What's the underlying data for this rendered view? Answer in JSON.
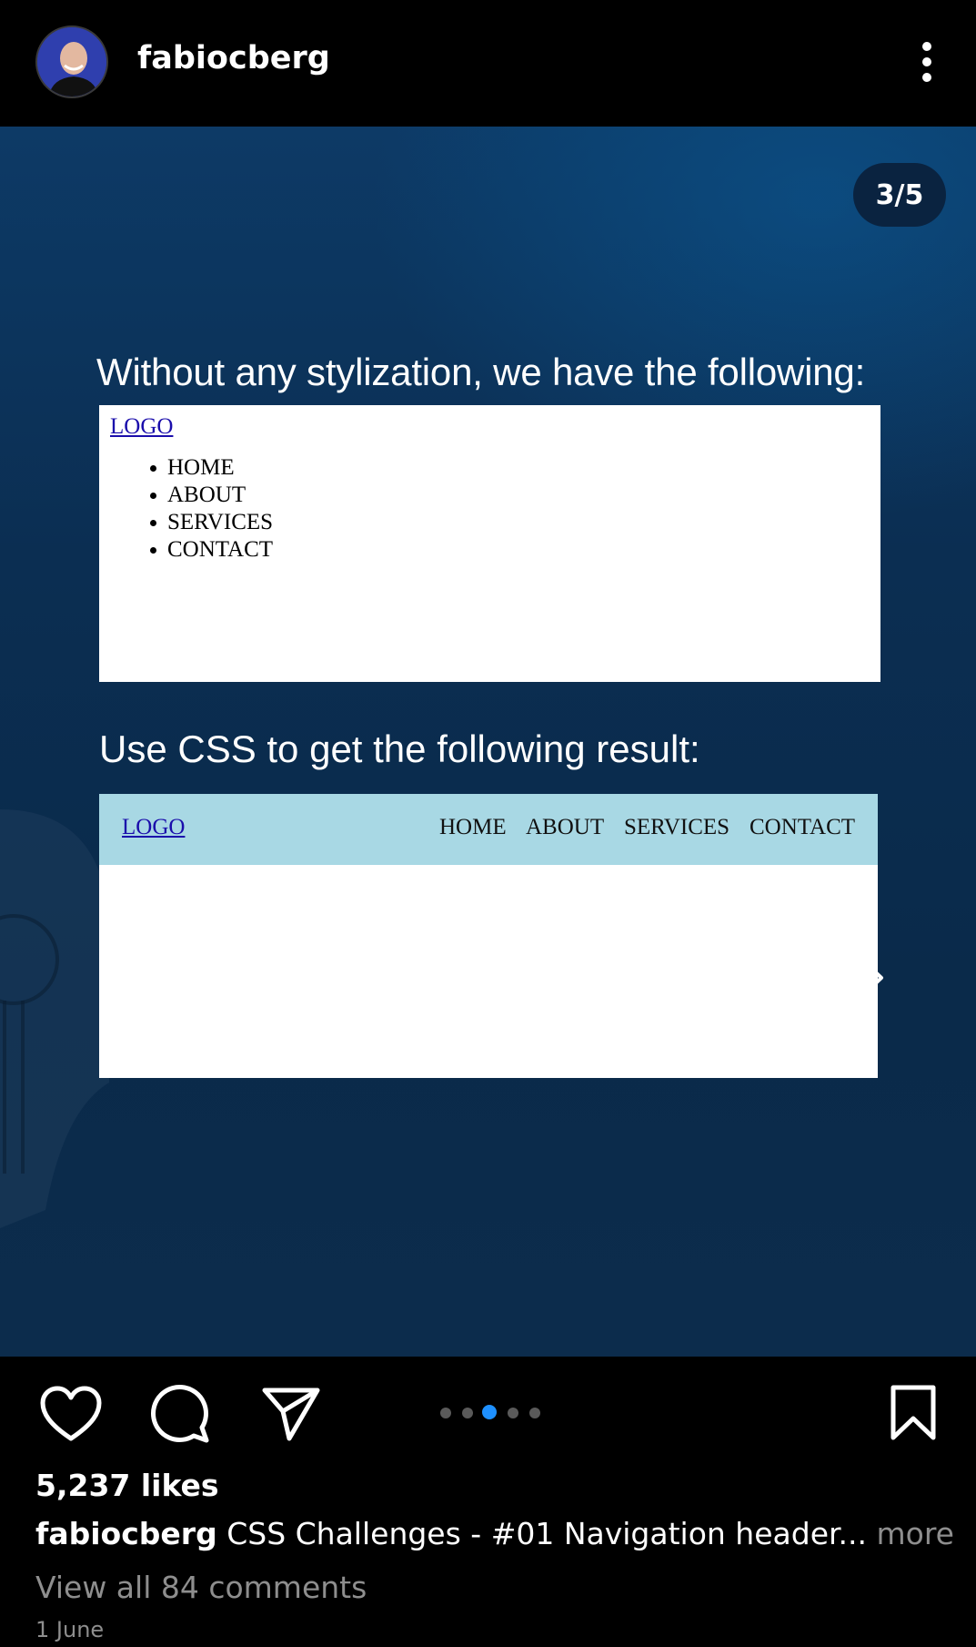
{
  "header": {
    "username": "fabiocberg",
    "avatar_icon": "profile-avatar",
    "more_icon": "more-vertical-icon"
  },
  "post": {
    "counter": "3/5",
    "intro_text": "Without any stylization, we have the following:",
    "unstyled": {
      "logo": "LOGO",
      "items": [
        "HOME",
        "ABOUT",
        "SERVICES",
        "CONTACT"
      ]
    },
    "instruction_text": "Use CSS to get the following result:",
    "styled": {
      "logo": "LOGO",
      "items": [
        "HOME",
        "ABOUT",
        "SERVICES",
        "CONTACT"
      ],
      "navbar_color": "#a8d8e4"
    },
    "arrow_icon": "arrow-right-icon"
  },
  "actions": {
    "like_icon": "heart-icon",
    "comment_icon": "comment-icon",
    "share_icon": "send-icon",
    "save_icon": "bookmark-icon",
    "carousel_total": 5,
    "carousel_active": 3
  },
  "meta": {
    "likes": "5,237 likes",
    "caption_user": "fabiocberg",
    "caption_text": "CSS Challenges - #01 Navigation header...",
    "caption_more": "more",
    "comments": "View all 84 comments",
    "date": "1 June"
  },
  "colors": {
    "accent_dot": "#1e90ff",
    "muted_text": "#8e8e8e"
  }
}
